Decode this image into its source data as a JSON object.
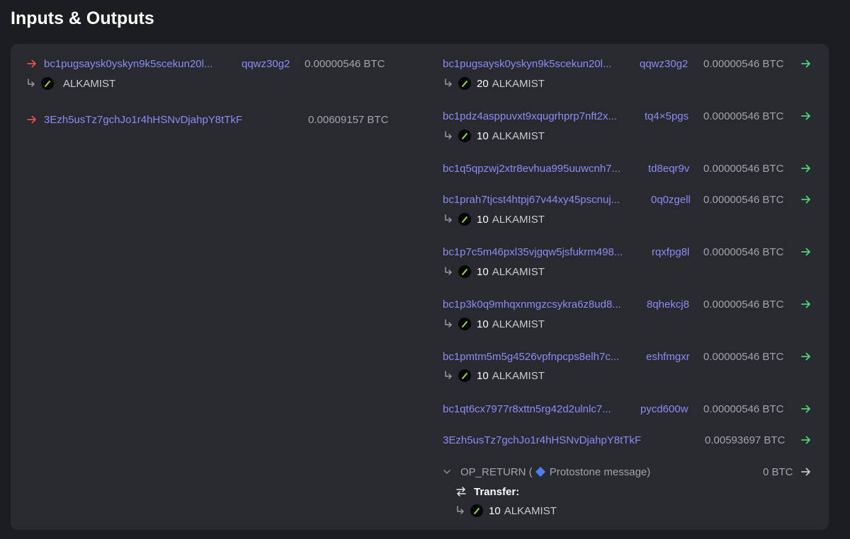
{
  "heading": "Inputs & Outputs",
  "colors": {
    "input_arrow": "#e5524a",
    "output_arrow": "#4fd17a",
    "address": "#8b8cf5",
    "token_glyph": "#8fdc3a"
  },
  "inputs": [
    {
      "address_head": "bc1pugsaysk0yskyn9k5scekun20l...",
      "address_tail": "qqwz30g2",
      "amount": "0.00000546 BTC",
      "rune": {
        "quantity": "",
        "symbol": "ALKAMIST"
      }
    },
    {
      "address_head": "3Ezh5usTz7gchJo1r4hHSNvDjahpY8tTkF",
      "address_tail": "",
      "amount": "0.00609157 BTC"
    }
  ],
  "outputs": [
    {
      "address_head": "bc1pugsaysk0yskyn9k5scekun20l...",
      "address_tail": "qqwz30g2",
      "amount": "0.00000546 BTC",
      "rune": {
        "quantity": "20",
        "symbol": "ALKAMIST"
      }
    },
    {
      "address_head": "bc1pdz4asppuvxt9xqugrhprp7nft2x...",
      "address_tail": "tq4×5pgs",
      "amount": "0.00000546 BTC",
      "rune": {
        "quantity": "10",
        "symbol": "ALKAMIST"
      }
    },
    {
      "address_head": "bc1q5qpzwj2xtr8evhua995uuwcnh7...",
      "address_tail": "td8eqr9v",
      "amount": "0.00000546 BTC"
    },
    {
      "address_head": "bc1prah7tjcst4htpj67v44xy45pscnuj...",
      "address_tail": "0q0zgell",
      "amount": "0.00000546 BTC",
      "rune": {
        "quantity": "10",
        "symbol": "ALKAMIST"
      }
    },
    {
      "address_head": "bc1p7c5m46pxl35vjgqw5jsfukrm498...",
      "address_tail": "rqxfpg8l",
      "amount": "0.00000546 BTC",
      "rune": {
        "quantity": "10",
        "symbol": "ALKAMIST"
      }
    },
    {
      "address_head": "bc1p3k0q9mhqxnmgzcsykra6z8ud8...",
      "address_tail": "8qhekcj8",
      "amount": "0.00000546 BTC",
      "rune": {
        "quantity": "10",
        "symbol": "ALKAMIST"
      }
    },
    {
      "address_head": "bc1pmtm5m5g4526vpfnpcps8elh7c...",
      "address_tail": "eshfmgxr",
      "amount": "0.00000546 BTC",
      "rune": {
        "quantity": "10",
        "symbol": "ALKAMIST"
      }
    },
    {
      "address_head": "bc1qt6cx7977r8xttn5rg42d2ulnlc7...",
      "address_tail": "pycd600w",
      "amount": "0.00000546 BTC"
    },
    {
      "address_head": "3Ezh5usTz7gchJo1r4hHSNvDjahpY8tTkF",
      "address_tail": "",
      "amount": "0.00593697 BTC"
    }
  ],
  "op_return": {
    "label": "OP_RETURN (",
    "message": "Protostone message)",
    "amount": "0 BTC",
    "transfer_label": "Transfer:",
    "rune": {
      "quantity": "10",
      "symbol": "ALKAMIST"
    }
  }
}
